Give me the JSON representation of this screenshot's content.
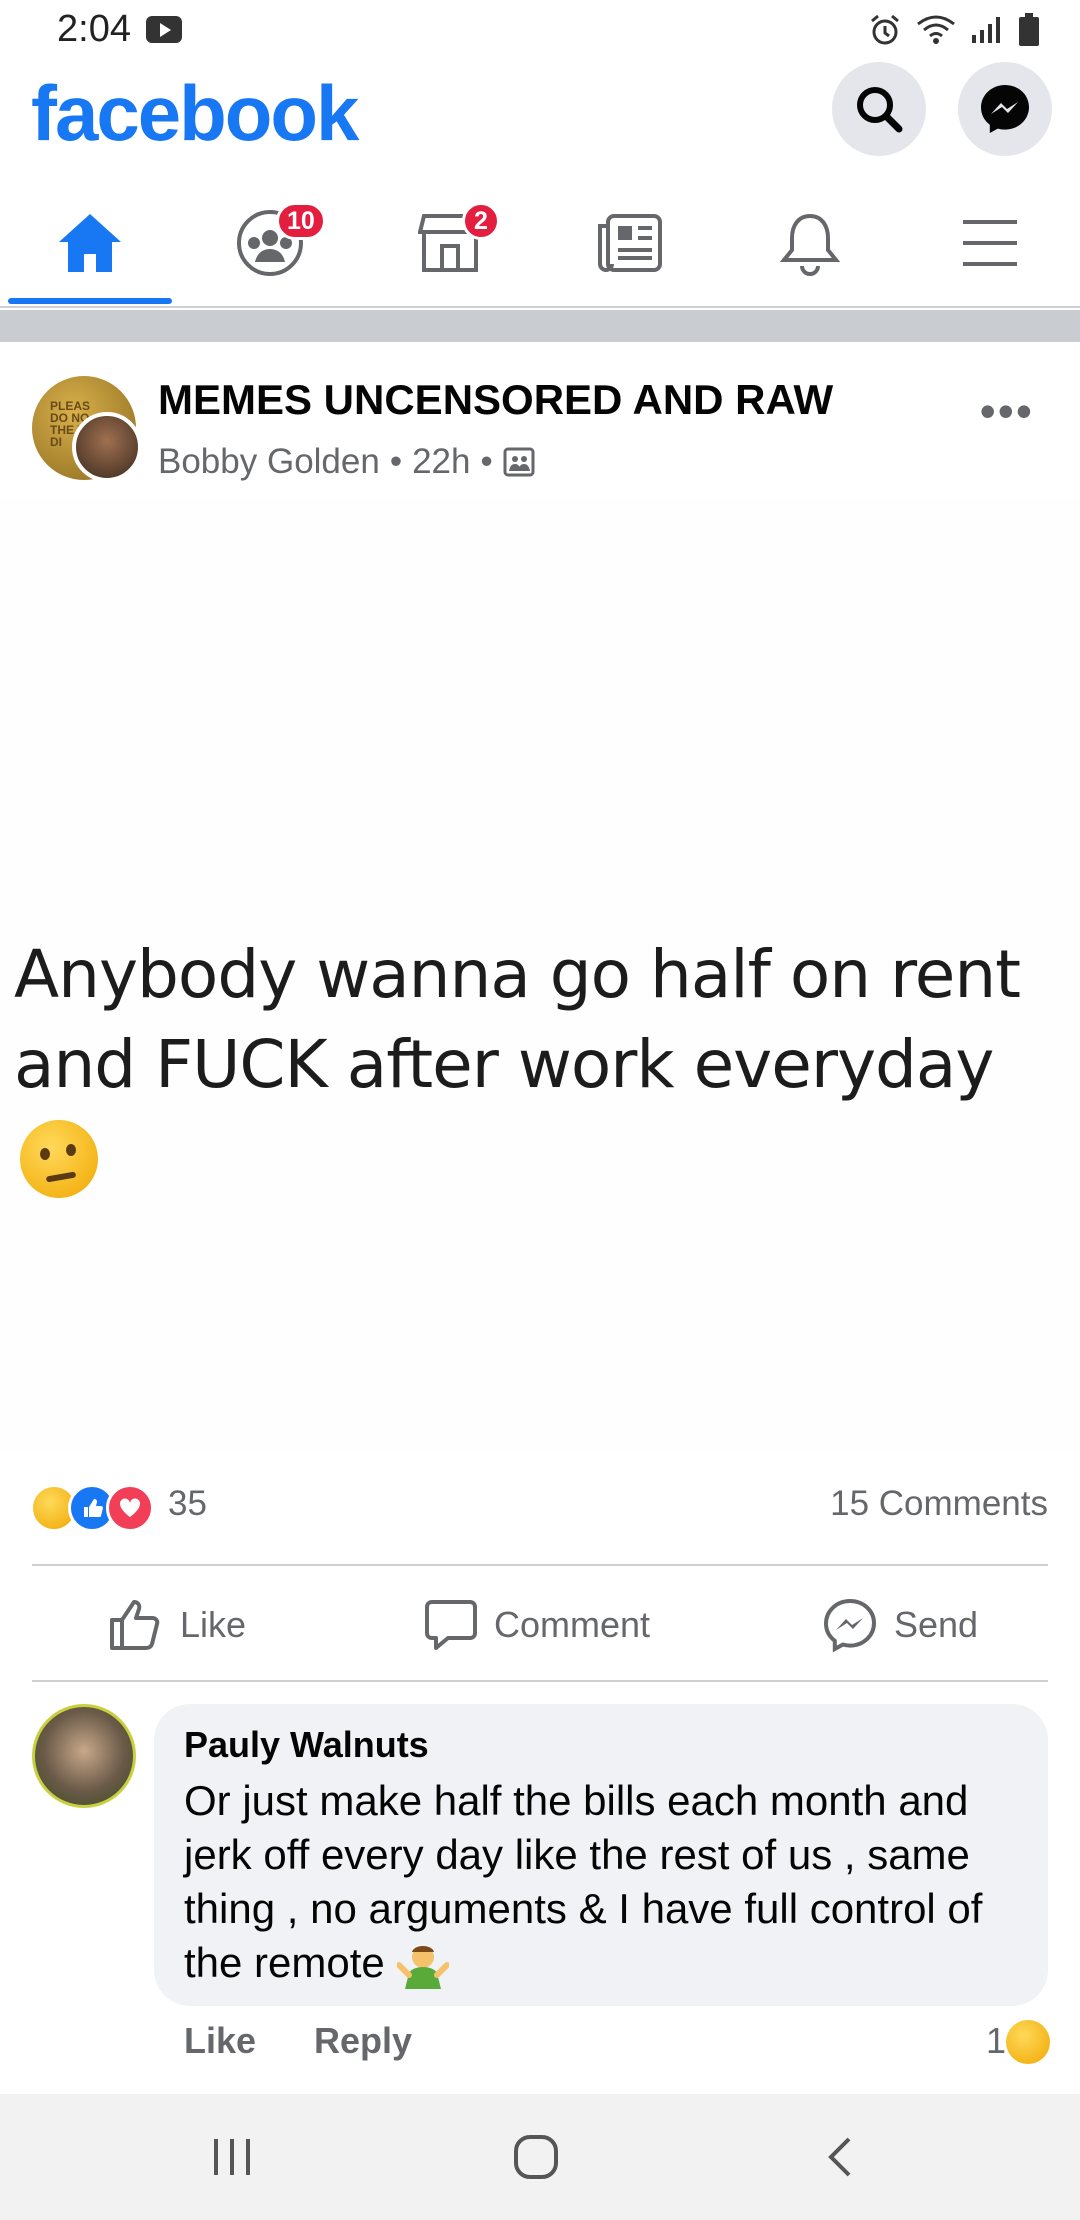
{
  "status_bar": {
    "time": "2:04"
  },
  "app": {
    "logo": "facebook"
  },
  "top_buttons": {
    "search_icon": "search-icon",
    "messenger_icon": "messenger-icon"
  },
  "nav": {
    "tabs": [
      {
        "name": "home",
        "icon": "home-icon",
        "active": true
      },
      {
        "name": "groups",
        "icon": "groups-icon",
        "badge": "10"
      },
      {
        "name": "marketplace",
        "icon": "marketplace-icon",
        "badge": "2"
      },
      {
        "name": "news",
        "icon": "news-icon"
      },
      {
        "name": "notifications",
        "icon": "bell-icon"
      },
      {
        "name": "menu",
        "icon": "menu-icon"
      }
    ],
    "accent": "#1877f2",
    "badge_color": "#e41e3f"
  },
  "post": {
    "group_name": "MEMES UNCENSORED AND RAW",
    "author": "Bobby Golden",
    "time": "22h",
    "privacy_icon": "group-privacy-icon",
    "text_line1": "Anybody wanna go half on rent",
    "text_line2": "and FUCK after work everyday",
    "reactions_count": "35",
    "comments_count": "15 Comments",
    "actions": {
      "like": "Like",
      "comment": "Comment",
      "send": "Send"
    }
  },
  "comment": {
    "author": "Pauly Walnuts",
    "text": "Or just make half the bills each month and jerk off every day like the rest of us , same thing , no arguments & I have full control of the remote",
    "like_label": "Like",
    "reply_label": "Reply",
    "reaction_count": "1"
  }
}
